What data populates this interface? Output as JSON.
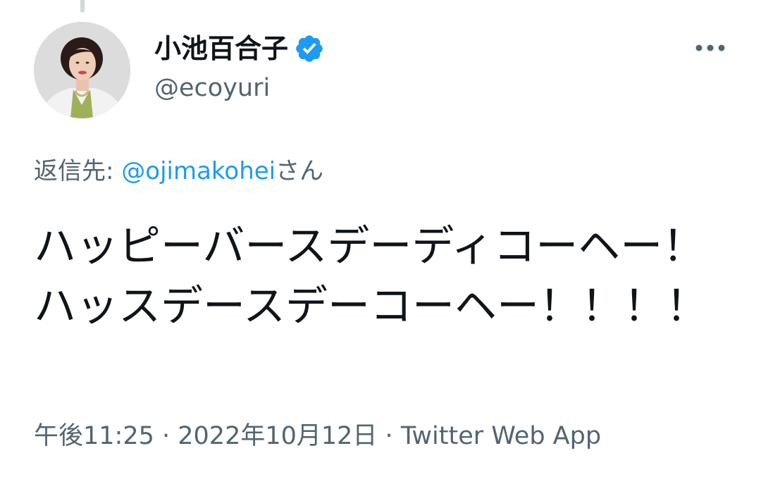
{
  "tweet": {
    "author": {
      "display_name": "小池百合子",
      "handle": "@ecoyuri",
      "verified_icon": "verified-badge-icon",
      "avatar_icon": "avatar-photo"
    },
    "more_icon": "more-horizontal-icon",
    "reply": {
      "prefix": "返信先: ",
      "mention": "@ojimakohei",
      "suffix": "さん"
    },
    "text": "ハッピーバースデーディコーヘー！ハッスデースデーコーヘー！！！！",
    "meta": {
      "time": "午後11:25",
      "separator": " · ",
      "date": "2022年10月12日",
      "source": "Twitter Web App"
    },
    "colors": {
      "accent": "#1d9bf0",
      "secondary_text": "#536471",
      "primary_text": "#0f1419"
    }
  }
}
